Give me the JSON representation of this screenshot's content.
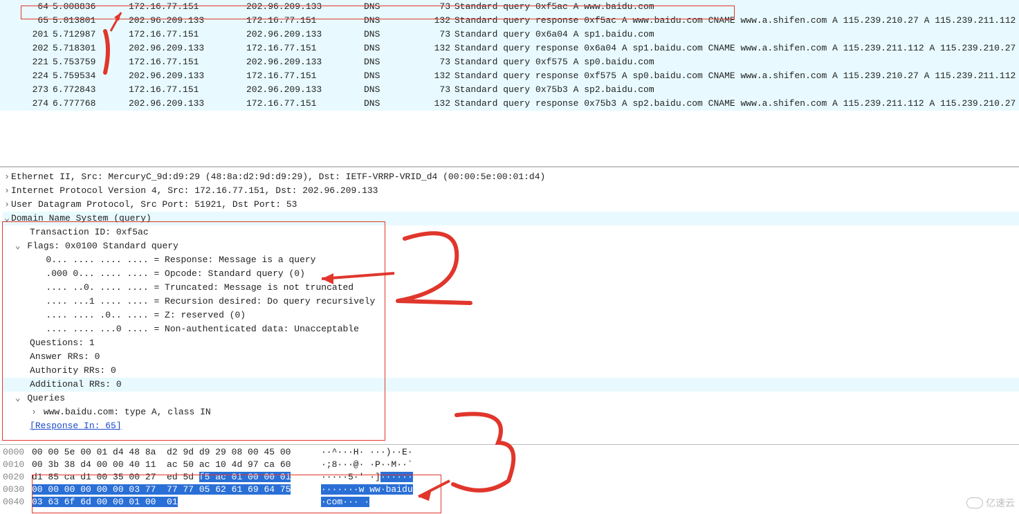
{
  "packets": [
    {
      "no": "64",
      "time": "5.008836",
      "src": "172.16.77.151",
      "dst": "202.96.209.133",
      "proto": "DNS",
      "len": "73",
      "info": "Standard query 0xf5ac A www.baidu.com"
    },
    {
      "no": "65",
      "time": "5.013801",
      "src": "202.96.209.133",
      "dst": "172.16.77.151",
      "proto": "DNS",
      "len": "132",
      "info": "Standard query response 0xf5ac A www.baidu.com CNAME www.a.shifen.com A 115.239.210.27 A 115.239.211.112"
    },
    {
      "no": "201",
      "time": "5.712987",
      "src": "172.16.77.151",
      "dst": "202.96.209.133",
      "proto": "DNS",
      "len": "73",
      "info": "Standard query 0x6a04 A sp1.baidu.com"
    },
    {
      "no": "202",
      "time": "5.718301",
      "src": "202.96.209.133",
      "dst": "172.16.77.151",
      "proto": "DNS",
      "len": "132",
      "info": "Standard query response 0x6a04 A sp1.baidu.com CNAME www.a.shifen.com A 115.239.211.112 A 115.239.210.27"
    },
    {
      "no": "221",
      "time": "5.753759",
      "src": "172.16.77.151",
      "dst": "202.96.209.133",
      "proto": "DNS",
      "len": "73",
      "info": "Standard query 0xf575 A sp0.baidu.com"
    },
    {
      "no": "224",
      "time": "5.759534",
      "src": "202.96.209.133",
      "dst": "172.16.77.151",
      "proto": "DNS",
      "len": "132",
      "info": "Standard query response 0xf575 A sp0.baidu.com CNAME www.a.shifen.com A 115.239.210.27 A 115.239.211.112"
    },
    {
      "no": "273",
      "time": "6.772843",
      "src": "172.16.77.151",
      "dst": "202.96.209.133",
      "proto": "DNS",
      "len": "73",
      "info": "Standard query 0x75b3 A sp2.baidu.com"
    },
    {
      "no": "274",
      "time": "6.777768",
      "src": "202.96.209.133",
      "dst": "172.16.77.151",
      "proto": "DNS",
      "len": "132",
      "info": "Standard query response 0x75b3 A sp2.baidu.com CNAME www.a.shifen.com A 115.239.211.112 A 115.239.210.27"
    }
  ],
  "detail": {
    "eth": "Ethernet II, Src: MercuryC_9d:d9:29 (48:8a:d2:9d:d9:29), Dst: IETF-VRRP-VRID_d4 (00:00:5e:00:01:d4)",
    "ip": "Internet Protocol Version 4, Src: 172.16.77.151, Dst: 202.96.209.133",
    "udp": "User Datagram Protocol, Src Port: 51921, Dst Port: 53",
    "dns": "Domain Name System (query)",
    "txid": "Transaction ID: 0xf5ac",
    "flags": "Flags: 0x0100 Standard query",
    "f1": "0... .... .... .... = Response: Message is a query",
    "f2": ".000 0... .... .... = Opcode: Standard query (0)",
    "f3": ".... ..0. .... .... = Truncated: Message is not truncated",
    "f4": ".... ...1 .... .... = Recursion desired: Do query recursively",
    "f5": ".... .... .0.. .... = Z: reserved (0)",
    "f6": ".... .... ...0 .... = Non-authenticated data: Unacceptable",
    "q": "Questions: 1",
    "an": "Answer RRs: 0",
    "au": "Authority RRs: 0",
    "ad": "Additional RRs: 0",
    "queries": "Queries",
    "query1": "www.baidu.com: type A, class IN",
    "resp": "[Response In: 65]"
  },
  "hex": {
    "rows": [
      {
        "off": "0000",
        "b1": "00 00 5e 00 01 d4 48 8a ",
        "b2": " d2 9d d9 29 08 00 45 00",
        "a": "··^···H· ···)··E·"
      },
      {
        "off": "0010",
        "b1": "00 3b 38 d4 00 00 40 11 ",
        "b2": " ac 50 ac 10 4d 97 ca 60",
        "a": "·;8···@· ·P··M··`"
      },
      {
        "off": "0020",
        "b1_plain": "d1 85 ca d1 00 35 00 27 ",
        "b2_plain": " ed 5d ",
        "b2_sel": "f5 ac 01 00 00 01",
        "a_plain": "·····5·' ·]",
        "a_sel": "······"
      },
      {
        "off": "0030",
        "b_sel": "00 00 00 00 00 00 03 77  77 77 05 62 61 69 64 75",
        "a_sel": "·······w ww·baidu"
      },
      {
        "off": "0040",
        "b_sel": "03 63 6f 6d 00 00 01 00  01",
        "a_sel": "·com··· ·"
      }
    ]
  },
  "watermark": "亿速云"
}
